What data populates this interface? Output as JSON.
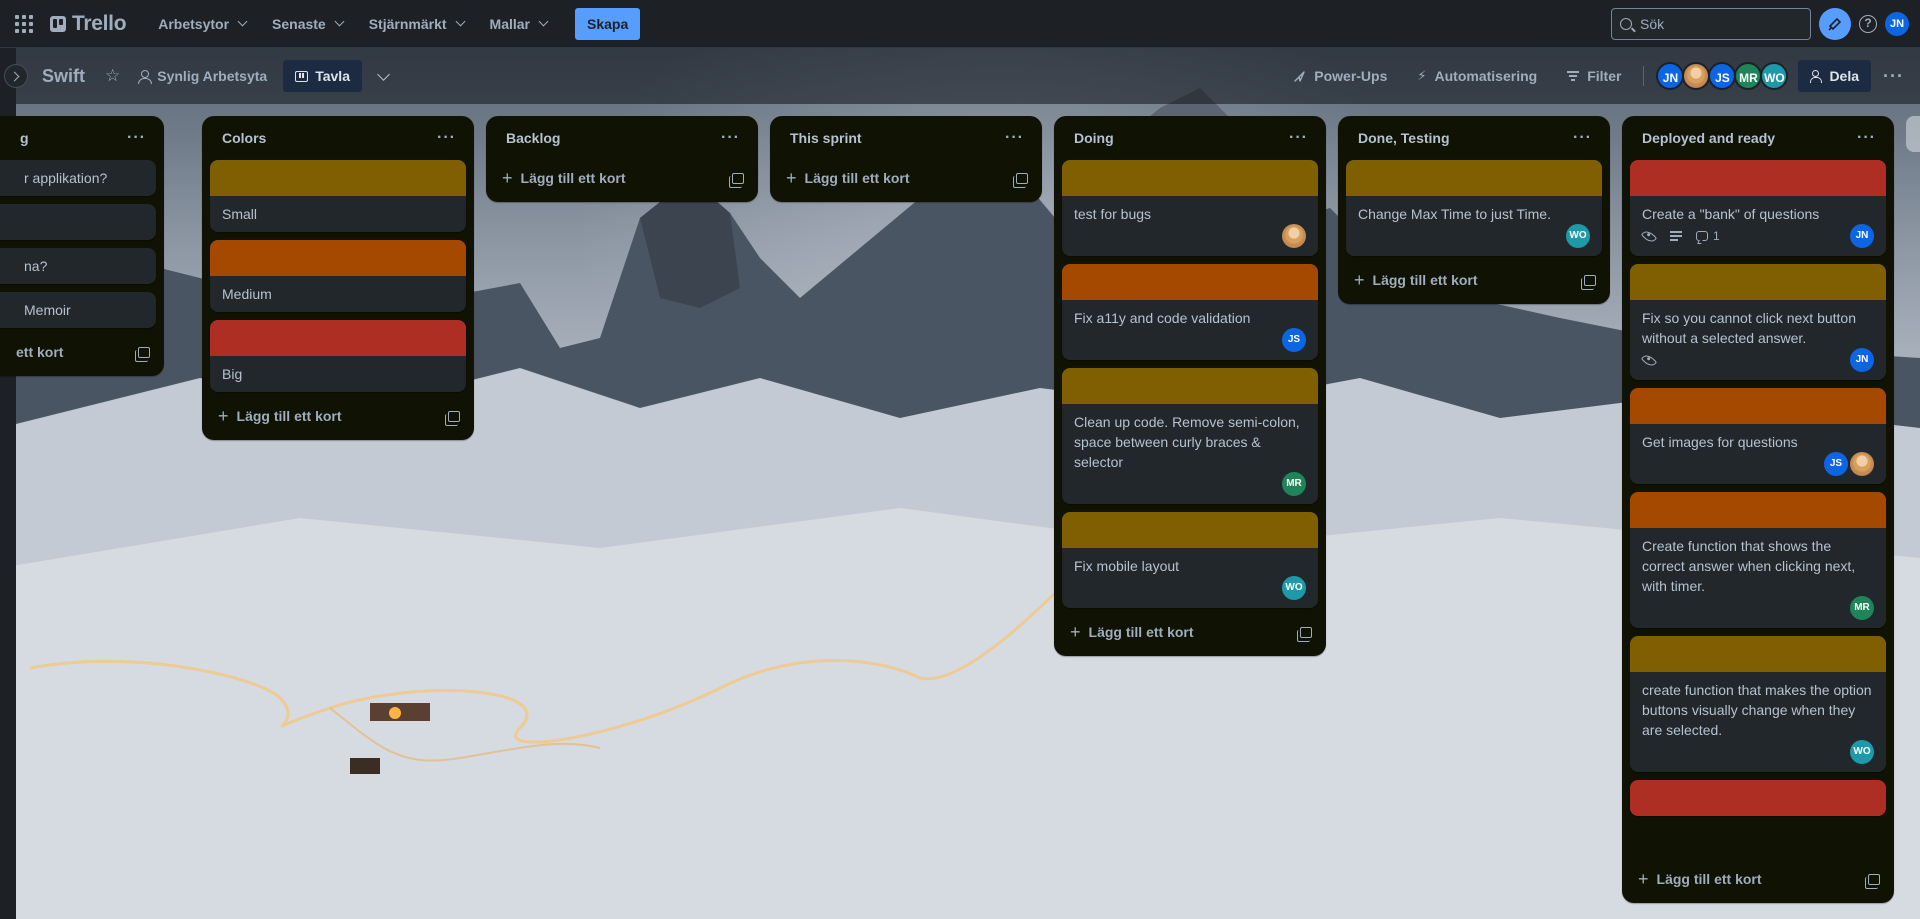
{
  "topnav": {
    "logo_text": "Trello",
    "menu": [
      {
        "label": "Arbetsytor"
      },
      {
        "label": "Senaste"
      },
      {
        "label": "Stjärnmärkt"
      },
      {
        "label": "Mallar"
      }
    ],
    "create_label": "Skapa",
    "search_placeholder": "Sök",
    "user_initials": "JN"
  },
  "board_header": {
    "title": "Swift",
    "visibility_label": "Synlig Arbetsyta",
    "view_label": "Tavla",
    "powerups_label": "Power-Ups",
    "automation_label": "Automatisering",
    "filter_label": "Filter",
    "members": [
      {
        "initials": "JN",
        "color": "#0c66e4"
      },
      {
        "initials": "",
        "color": "photo"
      },
      {
        "initials": "JS",
        "color": "#0c66e4"
      },
      {
        "initials": "MR",
        "color": "#1f845a"
      },
      {
        "initials": "WO",
        "color": "#1d9aaa"
      }
    ],
    "share_label": "Dela"
  },
  "labels": {
    "yellow": "#7f5f01",
    "orange": "#a54800",
    "red": "#ae2e24"
  },
  "lists": [
    {
      "title": "g",
      "cards": [
        {
          "title": "r applikation?"
        },
        {
          "title": ""
        },
        {
          "title": "na?"
        },
        {
          "title": " Memoir"
        }
      ],
      "add_label": "ett kort"
    },
    {
      "title": "Colors",
      "cards": [
        {
          "title": "Small"
        },
        {
          "title": "Medium"
        },
        {
          "title": "Big"
        }
      ],
      "add_label": "Lägg till ett kort"
    },
    {
      "title": "Backlog",
      "cards": [],
      "add_label": "Lägg till ett kort"
    },
    {
      "title": "This sprint",
      "cards": [],
      "add_label": "Lägg till ett kort"
    },
    {
      "title": "Doing",
      "cards": [
        {
          "title": "test for bugs"
        },
        {
          "title": "Fix a11y and code validation",
          "member": "JS"
        },
        {
          "title": "Clean up code. Remove semi-colon, space between curly braces & selector",
          "member": "MR"
        },
        {
          "title": "Fix mobile layout",
          "member": "WO"
        }
      ],
      "add_label": "Lägg till ett kort"
    },
    {
      "title": "Done, Testing",
      "cards": [
        {
          "title": "Change Max Time to just Time.",
          "member": "WO"
        }
      ],
      "add_label": "Lägg till ett kort"
    },
    {
      "title": "Deployed and ready",
      "cards": [
        {
          "title": "Create a \"bank\" of questions",
          "comments": "1",
          "member": "JN"
        },
        {
          "title": "Fix so you cannot click next button without a selected answer.",
          "member": "JN"
        },
        {
          "title": "Get images for questions",
          "member": "JS"
        },
        {
          "title": "Create function that shows the correct answer when clicking next, with timer.",
          "member": "MR"
        },
        {
          "title": "create function that makes the option buttons visually change when they are selected.",
          "member": "WO"
        }
      ],
      "add_label": "Lägg till ett kort"
    }
  ]
}
